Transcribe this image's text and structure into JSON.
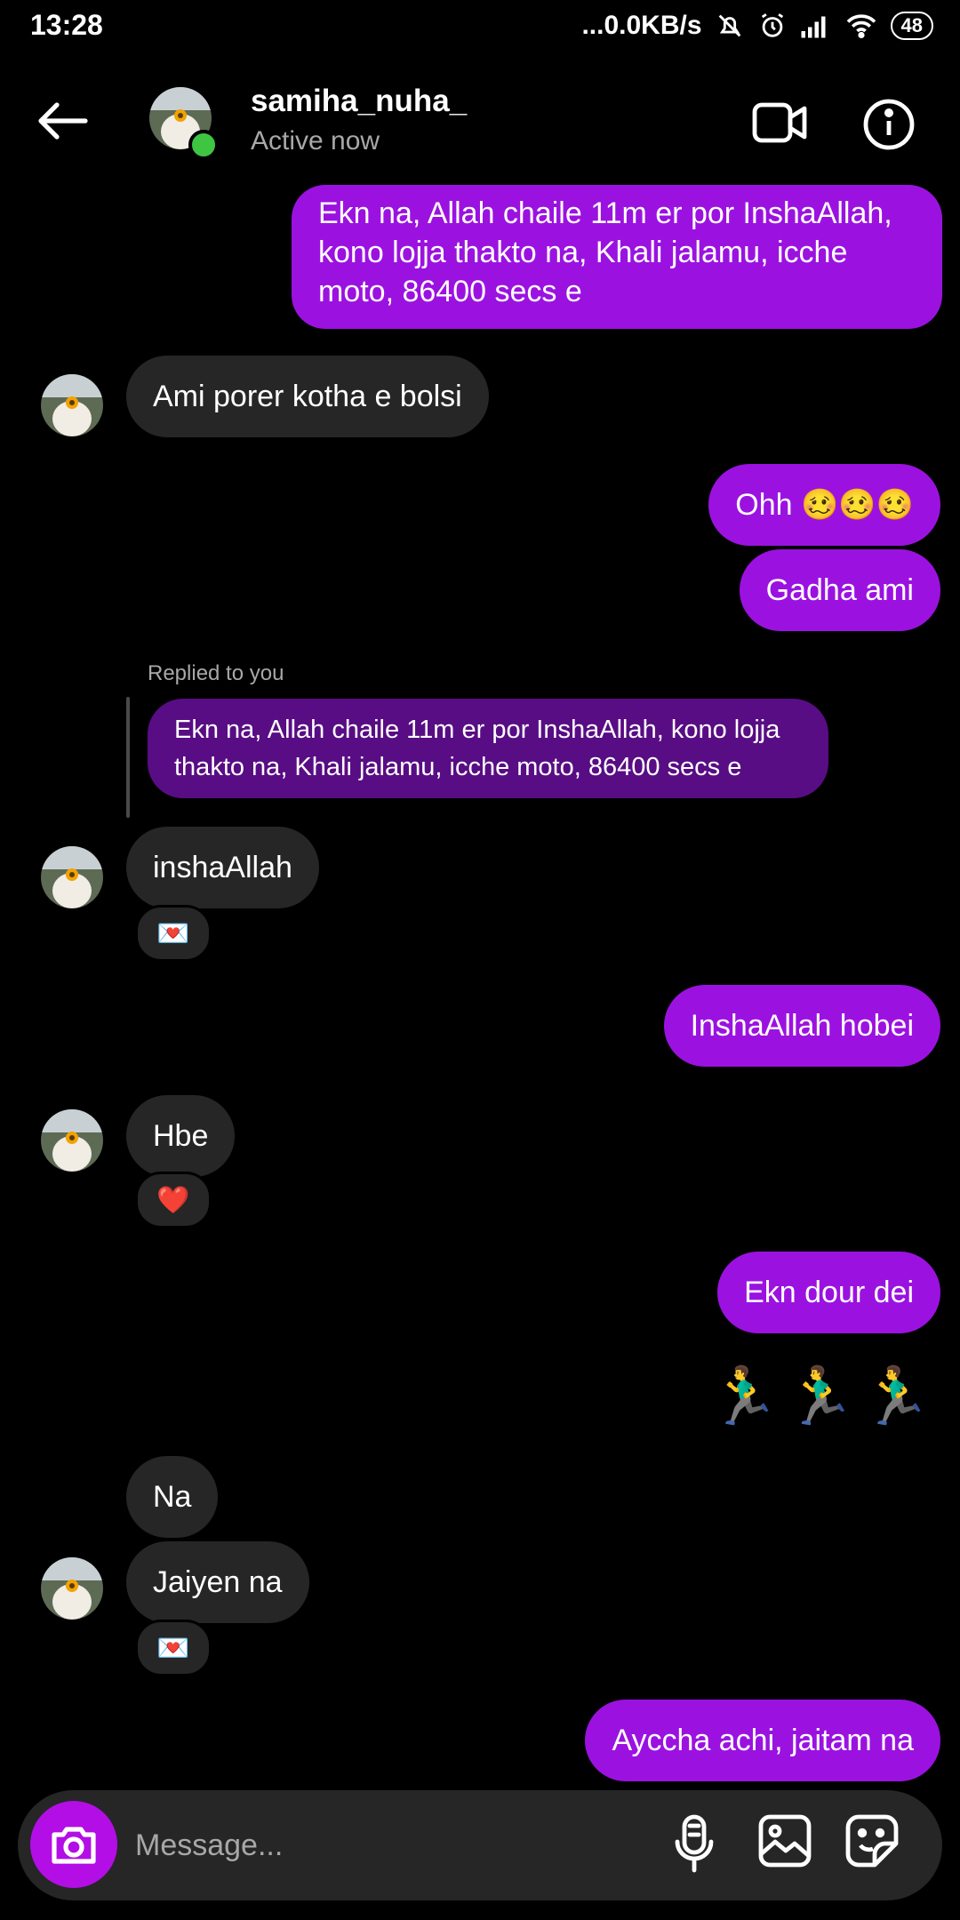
{
  "status_bar": {
    "time": "13:28",
    "network_speed": "...0.0KB/s",
    "battery": "48"
  },
  "header": {
    "username": "samiha_nuha_",
    "status": "Active now",
    "back_icon": "arrow-left-icon",
    "video_icon": "video-call-icon",
    "info_icon": "info-icon"
  },
  "messages": [
    {
      "side": "out",
      "text_lines": [
        "Ekn na, Allah chaile 11m er por InshaAllah,",
        "kono lojja thakto na, Khali jalamu, icche",
        "moto, 86400 secs e"
      ]
    },
    {
      "side": "in",
      "text": "Ami porer kotha e bolsi"
    },
    {
      "side": "out",
      "text": "Ohh 🥴🥴🥴"
    },
    {
      "side": "out",
      "text": "Gadha ami"
    },
    {
      "replied_label": "Replied to you",
      "quote_lines": [
        "Ekn na, Allah chaile 11m er por InshaAllah, kono lojja",
        "thakto na, Khali jalamu, icche moto, 86400 secs e"
      ]
    },
    {
      "side": "in",
      "text": "inshaAllah",
      "reaction": "💌"
    },
    {
      "side": "out",
      "text": "InshaAllah hobei"
    },
    {
      "side": "in",
      "text": "Hbe",
      "reaction": "❤️"
    },
    {
      "side": "out",
      "text": "Ekn dour dei"
    },
    {
      "side": "out",
      "text": "🏃‍♂️🏃‍♂️🏃‍♂️"
    },
    {
      "side": "in",
      "text": "Na"
    },
    {
      "side": "in",
      "text": "Jaiyen na",
      "reaction": "💌"
    },
    {
      "side": "out",
      "text": "Ayccha achi, jaitam na"
    }
  ],
  "composer": {
    "placeholder": "Message...",
    "camera_icon": "camera-icon",
    "mic_icon": "microphone-icon",
    "gallery_icon": "gallery-icon",
    "sticker_icon": "sticker-icon"
  },
  "colors": {
    "outgoing": "#9b12e0",
    "incoming": "#262626",
    "reply_quote": "#580d84",
    "online": "#3ec542"
  }
}
